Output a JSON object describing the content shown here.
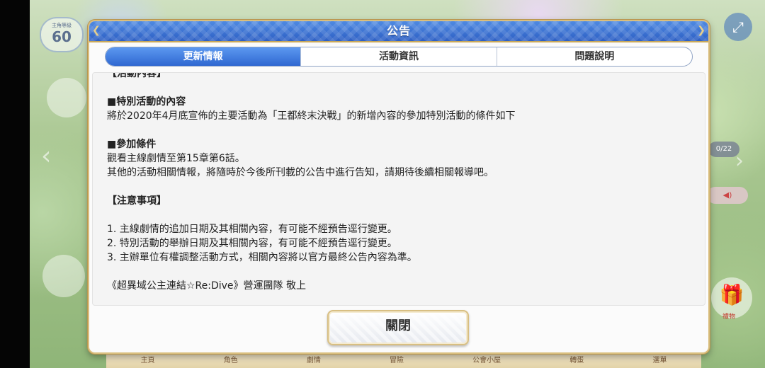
{
  "dialog": {
    "title": "公告",
    "tabs": [
      {
        "label": "更新情報",
        "active": true
      },
      {
        "label": "活動資訊",
        "active": false
      },
      {
        "label": "問題說明",
        "active": false
      }
    ],
    "content": {
      "top_partial": "【活動內容】",
      "section1_heading": "■特別活動的內容",
      "section1_text": "將於2020年4月底宣佈的主要活動為「王都終末決戰」的新增內容的參加特別活動的條件如下",
      "section2_heading": "■參加條件",
      "section2_line1": "觀看主線劇情至第15章第6話。",
      "section2_line2": "其他的活動相關情報，將隨時於今後所刊載的公告中進行告知，請期待後續相關報導吧。",
      "notes_heading": "【注意事項】",
      "notes": [
        "1. 主線劇情的追加日期及其相關內容，有可能不經預告逕行變更。",
        "2. 特別活動的舉辦日期及其相關內容，有可能不經預告逕行變更。",
        "3. 主辦單位有權調整活動方式，相關內容將以官方最終公告內容為準。"
      ],
      "signature": "《超異域公主連結☆Re:Dive》營運團隊 敬上"
    },
    "close_label": "關閉"
  },
  "background": {
    "level_caption": "主角等級",
    "level_value": "60",
    "counter": "0/22",
    "gift_label": "禮物",
    "nav_items": [
      "主頁",
      "角色",
      "劇情",
      "冒險",
      "公會小屋",
      "轉蛋",
      "選單"
    ]
  },
  "colors": {
    "header_blue": "#2d5fc4",
    "tab_active": "#2f67d1",
    "border_gold": "#d9be7d"
  }
}
